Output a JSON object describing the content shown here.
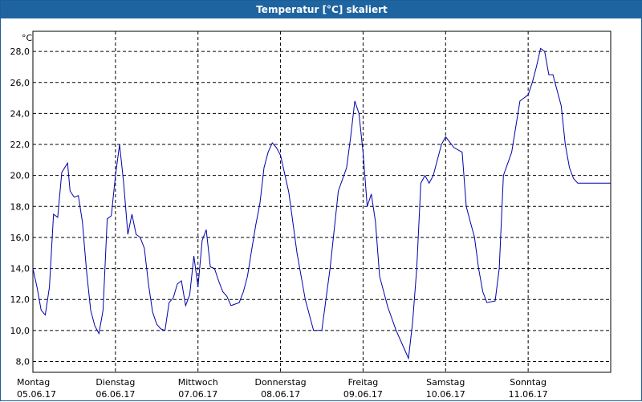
{
  "window": {
    "title": "Temperatur [°C] skaliert"
  },
  "chart_data": {
    "type": "line",
    "title": "Temperatur [°C] skaliert",
    "ylabel": "°C",
    "xlabel": "",
    "ylim": [
      7.3,
      29.3
    ],
    "xlim": [
      0,
      7
    ],
    "y_ticks": [
      "8,0",
      "10,0",
      "12,0",
      "14,0",
      "16,0",
      "18,0",
      "20,0",
      "22,0",
      "24,0",
      "26,0",
      "28,0"
    ],
    "y_tick_values": [
      8,
      10,
      12,
      14,
      16,
      18,
      20,
      22,
      24,
      26,
      28
    ],
    "x_ticks": [
      {
        "day": "Montag",
        "date": "05.06.17"
      },
      {
        "day": "Dienstag",
        "date": "06.06.17"
      },
      {
        "day": "Mittwoch",
        "date": "07.06.17"
      },
      {
        "day": "Donnerstag",
        "date": "08.06.17"
      },
      {
        "day": "Freitag",
        "date": "09.06.17"
      },
      {
        "day": "Samstag",
        "date": "10.06.17"
      },
      {
        "day": "Sonntag",
        "date": "11.06.17"
      }
    ],
    "grid": true,
    "line_color": "#0000aa",
    "series": [
      {
        "x": [
          0.0,
          0.05,
          0.1,
          0.15,
          0.2,
          0.25,
          0.3,
          0.35,
          0.42,
          0.45,
          0.5,
          0.55,
          0.6,
          0.65,
          0.7,
          0.75,
          0.8,
          0.85,
          0.9,
          0.95,
          1.0,
          1.05,
          1.1,
          1.15,
          1.2,
          1.25,
          1.3,
          1.35,
          1.4,
          1.45,
          1.5,
          1.55,
          1.6,
          1.65,
          1.7,
          1.75,
          1.8,
          1.85,
          1.9,
          1.95,
          2.0,
          2.05,
          2.1,
          2.15,
          2.2,
          2.25,
          2.3,
          2.35,
          2.4,
          2.45,
          2.5,
          2.55,
          2.6,
          2.65,
          2.7,
          2.75,
          2.8,
          2.85,
          2.9,
          2.95,
          3.0,
          3.1,
          3.2,
          3.3,
          3.4,
          3.5,
          3.6,
          3.7,
          3.8,
          3.85,
          3.9,
          3.95,
          4.0,
          4.05,
          4.1,
          4.15,
          4.2,
          4.3,
          4.4,
          4.5,
          4.55,
          4.6,
          4.65,
          4.7,
          4.75,
          4.8,
          4.85,
          4.9,
          4.95,
          5.0,
          5.1,
          5.2,
          5.25,
          5.3,
          5.35,
          5.4,
          5.45,
          5.5,
          5.6,
          5.65,
          5.7,
          5.8,
          5.9,
          6.0,
          6.05,
          6.1,
          6.15,
          6.2,
          6.25,
          6.3,
          6.4,
          6.45,
          6.5,
          6.55,
          6.6,
          6.65,
          6.7,
          6.75,
          6.8,
          6.85,
          6.9,
          6.95,
          7.0
        ],
        "y": [
          14.0,
          12.8,
          11.3,
          11.0,
          12.8,
          17.5,
          17.3,
          20.2,
          20.8,
          19.0,
          18.6,
          18.7,
          17.0,
          13.8,
          11.3,
          10.3,
          9.8,
          11.3,
          17.2,
          17.4,
          20.0,
          22.0,
          19.5,
          16.2,
          17.5,
          16.2,
          16.0,
          15.3,
          13.0,
          11.2,
          10.4,
          10.1,
          10.0,
          11.8,
          12.1,
          13.0,
          13.2,
          11.6,
          12.3,
          14.8,
          12.8,
          15.8,
          16.5,
          14.1,
          14.0,
          13.2,
          12.5,
          12.2,
          11.6,
          11.7,
          11.8,
          12.5,
          13.5,
          15.2,
          16.8,
          18.2,
          20.5,
          21.5,
          22.1,
          21.8,
          21.3,
          18.9,
          15.0,
          12.0,
          10.0,
          10.0,
          14.0,
          19.0,
          20.5,
          22.5,
          24.8,
          24.0,
          21.5,
          18.0,
          18.8,
          17.0,
          13.5,
          11.5,
          10.0,
          8.8,
          8.2,
          10.5,
          14.0,
          19.5,
          20.0,
          19.5,
          20.0,
          21.0,
          22.0,
          22.5,
          21.8,
          21.5,
          18.0,
          17.0,
          16.0,
          14.0,
          12.5,
          11.8,
          11.9,
          14.0,
          20.0,
          21.5,
          24.8,
          25.2,
          26.0,
          27.0,
          28.2,
          28.0,
          26.5,
          26.5,
          24.5,
          22.0,
          20.5,
          19.8,
          19.5,
          19.5,
          19.5,
          19.5,
          19.5,
          19.5,
          19.5,
          19.5,
          19.5
        ]
      }
    ]
  }
}
